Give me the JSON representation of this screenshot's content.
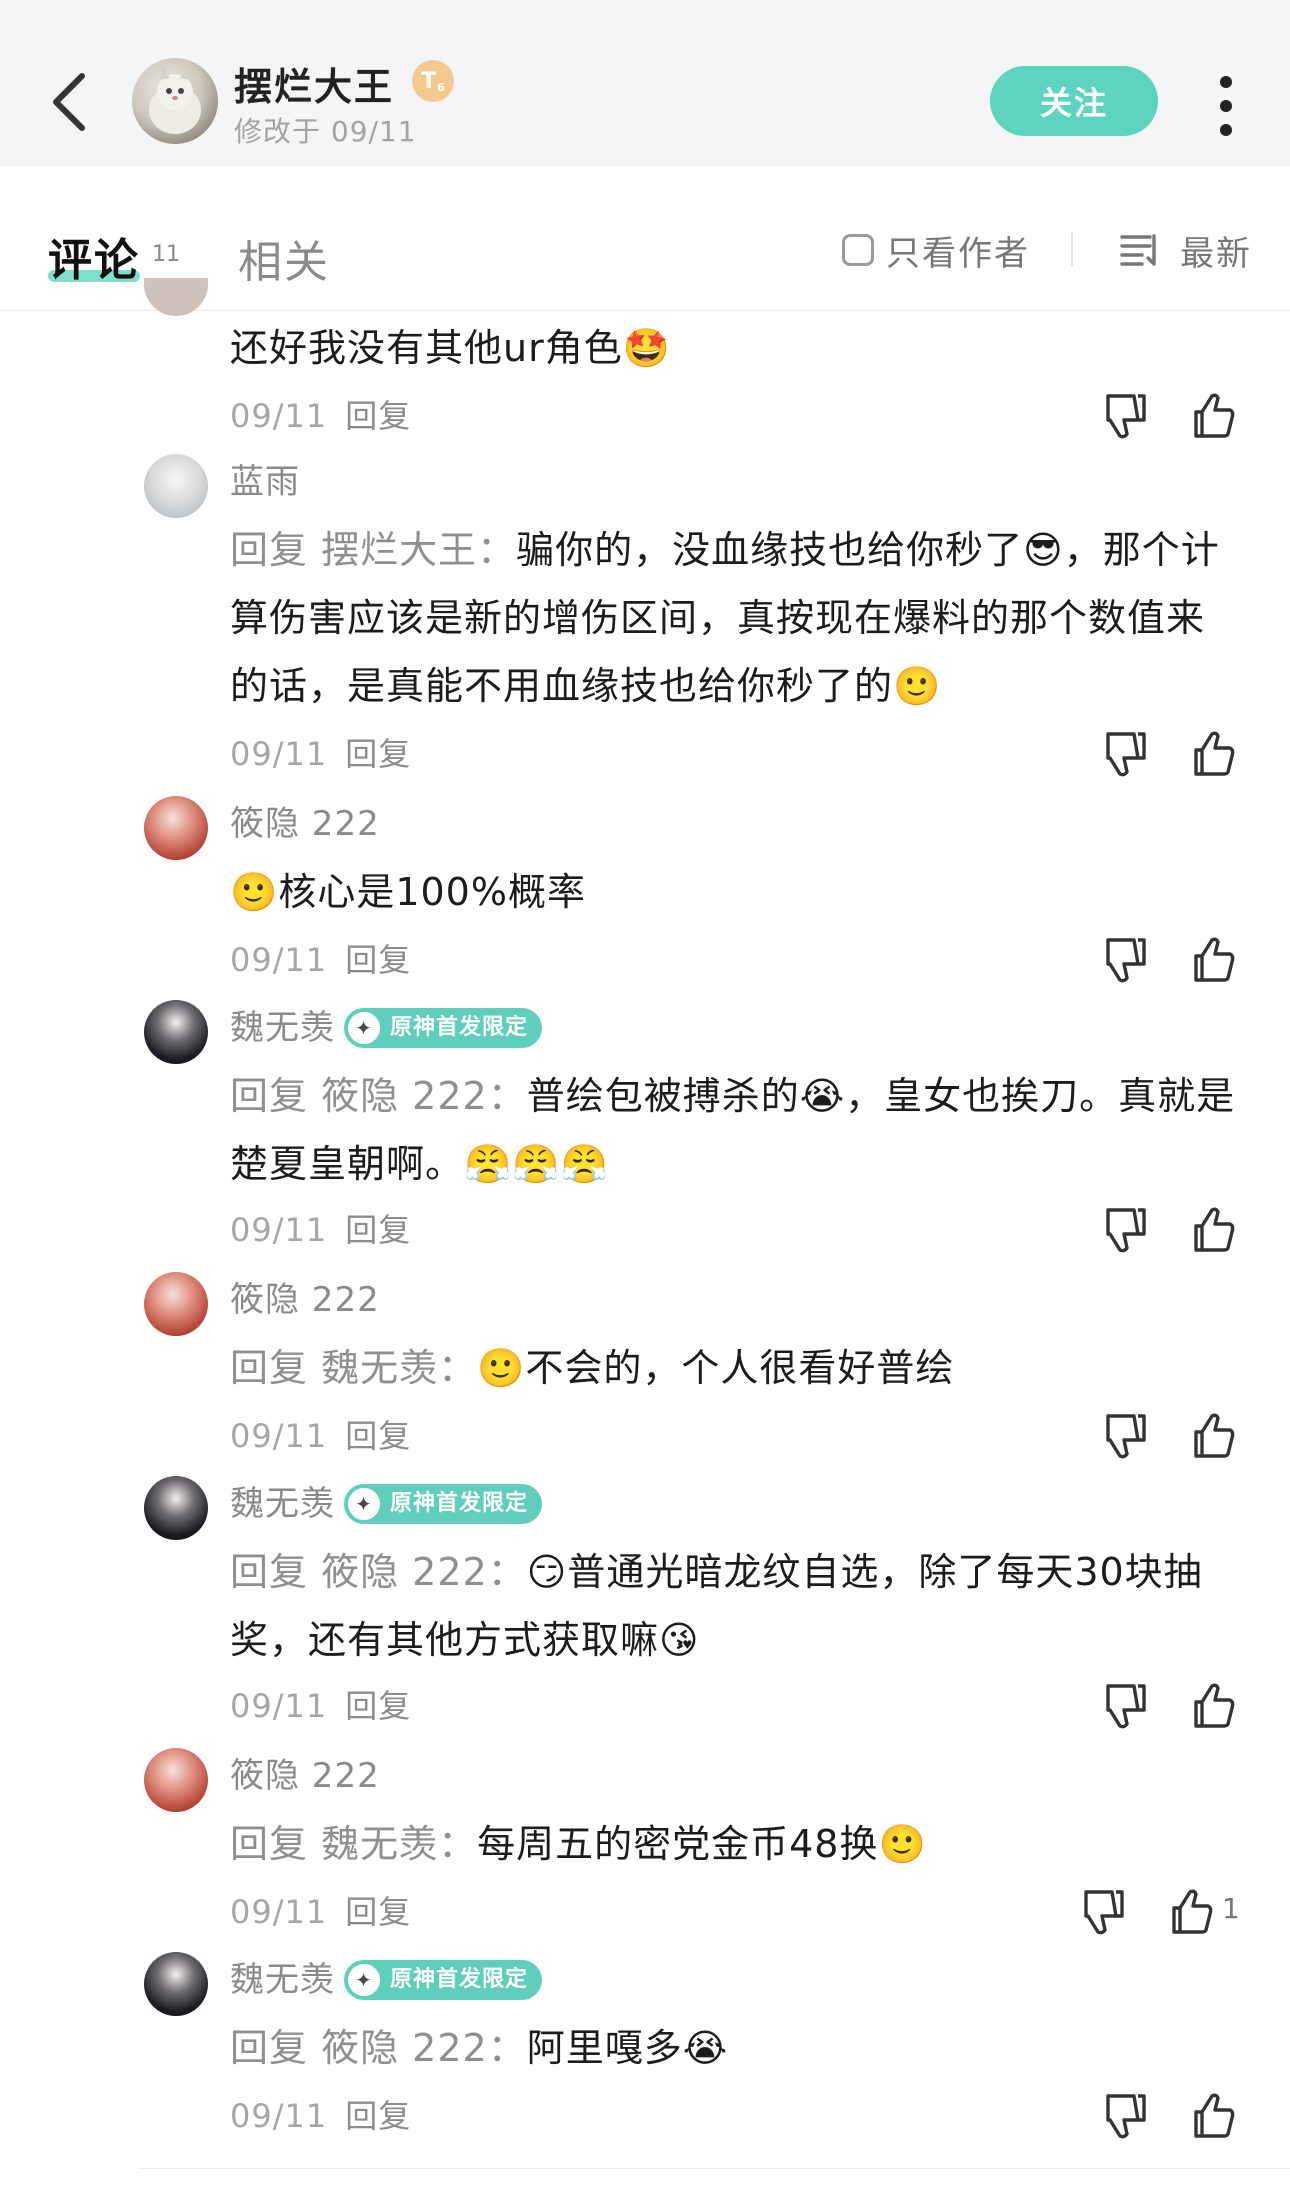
{
  "header": {
    "author_name": "摆烂大王",
    "level_badge": "T",
    "level_sub": "6",
    "edited": "修改于 09/11",
    "follow_label": "关注"
  },
  "tabs": {
    "comments_label": "评论",
    "comments_count": "11",
    "related_label": "相关",
    "only_author_label": "只看作者",
    "sort_label": "最新"
  },
  "comments": [
    {
      "user": "",
      "tag": "",
      "reply_prefix": "",
      "text": "还好我没有其他ur角色",
      "emoji": "🤩",
      "date": "09/11",
      "reply_label": "回复",
      "likes": ""
    },
    {
      "user": "蓝雨",
      "tag": "",
      "reply_prefix": "回复 摆烂大王：",
      "text": "骗你的，没血缘技也给你秒了😎，那个计算伤害应该是新的增伤区间，真按现在爆料的那个数值来的话，是真能不用血缘技也给你秒了的",
      "emoji": "🙂",
      "date": "09/11",
      "reply_label": "回复",
      "likes": ""
    },
    {
      "user": "筱隐 222",
      "tag": "",
      "reply_prefix": "",
      "text": "🙂核心是100%概率",
      "emoji": "",
      "date": "09/11",
      "reply_label": "回复",
      "likes": ""
    },
    {
      "user": "魏无羡",
      "tag": "原神首发限定",
      "reply_prefix": "回复 筱隐 222：",
      "text": "普绘包被搏杀的😭，皇女也挨刀。真就是楚夏皇朝啊。",
      "emoji": "😤😤😤",
      "date": "09/11",
      "reply_label": "回复",
      "likes": ""
    },
    {
      "user": "筱隐 222",
      "tag": "",
      "reply_prefix": "回复 魏无羡：",
      "text": "🙂不会的，个人很看好普绘",
      "emoji": "",
      "date": "09/11",
      "reply_label": "回复",
      "likes": ""
    },
    {
      "user": "魏无羡",
      "tag": "原神首发限定",
      "reply_prefix": "回复 筱隐 222：",
      "text": "😏普通光暗龙纹自选，除了每天30块抽奖，还有其他方式获取嘛",
      "emoji": "😘",
      "date": "09/11",
      "reply_label": "回复",
      "likes": ""
    },
    {
      "user": "筱隐 222",
      "tag": "",
      "reply_prefix": "回复 魏无羡：",
      "text": "每周五的密党金币48换",
      "emoji": "🙂",
      "date": "09/11",
      "reply_label": "回复",
      "likes": "1"
    },
    {
      "user": "魏无羡",
      "tag": "原神首发限定",
      "reply_prefix": "回复 筱隐 222：",
      "text": "阿里嘎多",
      "emoji": "😭",
      "date": "09/11",
      "reply_label": "回复",
      "likes": ""
    }
  ],
  "colors": {
    "accent": "#5dd4bd",
    "header_bg": "#f4f5f7",
    "muted_text": "#a6a6a6"
  }
}
